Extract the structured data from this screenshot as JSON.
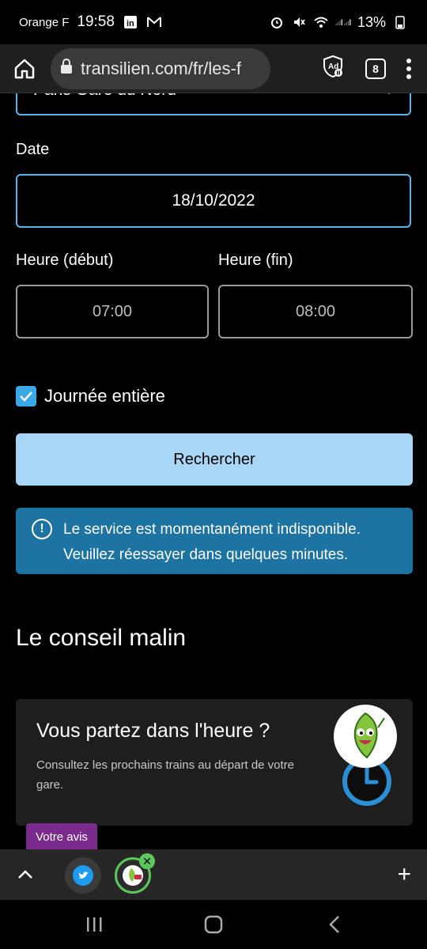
{
  "status_bar": {
    "carrier": "Orange F",
    "time": "19:58",
    "battery": "13%"
  },
  "browser": {
    "url": "transilien.com/fr/les-f",
    "tab_count": "8"
  },
  "form": {
    "station_value": "Paris Gare du Nord",
    "date_label": "Date",
    "date_value": "18/10/2022",
    "start_label": "Heure (début)",
    "start_value": "07:00",
    "end_label": "Heure (fin)",
    "end_value": "08:00",
    "all_day_label": "Journée entière",
    "all_day_checked": true,
    "search_label": "Rechercher"
  },
  "alert": {
    "message": "Le service est momentanément indisponible. Veuillez réessayer dans quelques minutes."
  },
  "tip_section": {
    "title": "Le conseil malin",
    "card_title": "Vous partez dans l'heure ?",
    "card_text": "Consultez les prochains trains au départ de votre gare."
  },
  "feedback": {
    "label": "Votre avis"
  },
  "colors": {
    "accent": "#5bb3e8",
    "button": "#a8d6f6",
    "alert_bg": "#1d73a1",
    "feedback_bg": "#7b2b8e"
  }
}
